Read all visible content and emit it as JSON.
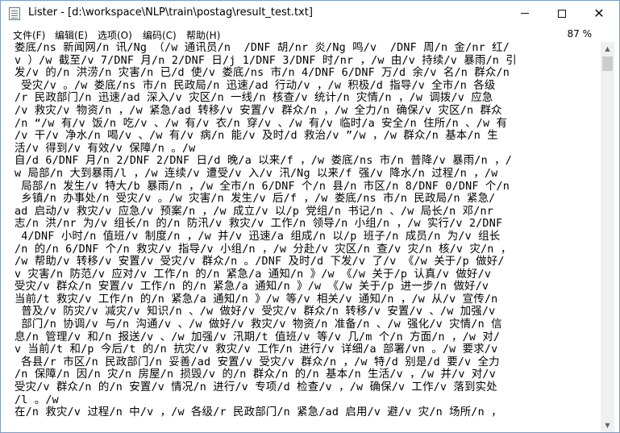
{
  "window": {
    "title": "Lister - [d:\\workspace\\NLP\\train\\postag\\result_test.txt]",
    "icon": "text-file-icon",
    "controls": {
      "minimize": "minimize-icon",
      "maximize": "maximize-icon",
      "close": "✕"
    }
  },
  "menubar": {
    "items": [
      {
        "label": "文件(F)"
      },
      {
        "label": "编辑(E)"
      },
      {
        "label": "选项(O)"
      },
      {
        "label": "编码(C)"
      },
      {
        "label": "帮助(H)"
      }
    ],
    "zoom": "87 %"
  },
  "content": {
    "lines": [
      "娄底/ns 新闻网/n 讯/Ng （/w 通讯员/n  /DNF 胡/nr 炎/Ng 鸣/v  /DNF 周/n 金/nr 红/",
      "v ）/w 截至/v 7/DNF 月/n 2/DNF 日/j 1/DNF 3/DNF 时/nr ，/w 由/v 持续/v 暴雨/n 引",
      "发/v 的/n 洪涝/n 灾害/n 已/d 使/v 娄底/ns 市/n 4/DNF 6/DNF 万/d 余/v 名/n 群众/n",
      " 受灾/v 。/w 娄底/ns 市/n 民政局/n 迅速/ad 行动/v ，/w 积极/d 指导/v 全市/n 各级",
      "/r 民政部门/n 迅速/ad 深入/v 灾区/n 一线/n 核查/v 统计/n 灾情/n ，/w 调拨/v 应急",
      "/v 救灾/v 物资/n ，/w 紧急/ad 转移/v 安置/v 群众/n ，/w 全力/n 确保/v 灾区/n 群众",
      "/n “/w 有/v 饭/n 吃/v 、/w 有/v 衣/n 穿/v 、/w 有/v 临时/a 安全/n 住所/n 、/w 有",
      "/v 干/v 净水/n 喝/v 、/w 有/v 病/n 能/v 及时/d 救治/v ”/w ，/w 群众/n 基本/n 生",
      "活/v 得到/v 有效/v 保障/n 。/w",
      "自/d 6/DNF 月/n 2/DNF 2/DNF 日/d 晚/a 以来/f ，/w 娄底/ns 市/n 普降/v 暴雨/n ，/",
      "w 局部/n 大到暴雨/l ，/w 连续/v 遭受/v 入/v 汛/Ng 以来/f 强/v 降水/n 过程/n ，/w",
      " 局部/n 发生/v 特大/b 暴雨/n ，/w 全市/n 6/DNF 个/n 县/n 市区/n 8/DNF 0/DNF 个/n",
      " 乡镇/n 办事处/n 受灾/v 。/w 灾害/n 发生/v 后/f ，/w 娄底/ns 市/n 民政局/n 紧急/",
      "ad 启动/v 救灾/v 应急/v 预案/n ，/w 成立/v 以/p 党组/n 书记/n 、/w 局长/n 邓/nr",
      "志/n 洪/nr 为/v 组长/n 的/n 防汛/v 救灾/v 工作/n 领导/n 小组/n ，/w 实行/v 2/DNF",
      " 4/DNF 小时/n 值班/v 制度/n ，/w 并/v 迅速/a 组成/n 以/p 班子/n 成员/n 为/v 组长",
      "/n 的/n 6/DNF 个/n 救灾/v 指导/v 小组/n ，/w 分赴/v 灾区/n 查/v 灾/n 核/v 灾/n ，",
      "/w 帮助/v 转移/v 安置/v 受灾/v 群众/n 。/DNF 及时/d 下发/v 了/v 《/w 关于/p 做好/",
      "v 灾害/n 防范/v 应对/v 工作/n 的/n 紧急/a 通知/n 》/w 《/w 关于/p 认真/v 做好/v",
      "受灾/v 群众/n 安置/v 工作/n 的/n 紧急/a 通知/n 》/w 《/w 关于/p 进一步/n 做好/v",
      "当前/t 救灾/v 工作/n 的/n 紧急/a 通知/n 》/w 等/v 相关/v 通知/n ，/w 从/v 宣传/n",
      " 普及/v 防灾/v 减灾/v 知识/n 、/w 做好/v 受灾/v 群众/n 转移/v 安置/v 、/w 加强/v",
      " 部门/n 协调/v 与/n 沟通/v 、/w 做好/v 救灾/v 物资/n 准备/n 、/w 强化/v 灾情/n 信",
      "息/n 管理/v 和/n 报送/v 、/w 加强/v 汛期/t 值班/v 等/v 几/m 个/n 方面/n ，/w 对/",
      "v 当前/t 和/p 今后/t 的/n 抗灾/v 救灾/v 工作/n 进行/v 详细/a 部署/vn 。/w 要求/v",
      " 各县/r 市区/n 民政部门/n 妥善/ad 安置/v 受灾/v 群众/n ，/w 特/d 别是/d 要/v 全力",
      "/n 保障/n 因/n 灾/n 房屋/n 损毁/v 的/n 群众/n 的/n 基本/n 生活/v ，/w 并/v 对/v",
      "受灾/v 群众/n 的/n 安置/v 情况/n 进行/v 专项/d 检查/v ，/w 确保/v 工作/v 落到实处",
      "/l 。/w",
      "在/n 救灾/v 过程/n 中/v ，/w 各级/r 民政部门/n 紧急/ad 启用/v 避/v 灾/n 场所/n ，"
    ]
  },
  "scrollbar": {
    "up_icon": "scroll-up-arrow-icon",
    "down_icon": "scroll-down-arrow-icon",
    "position": 0.0
  }
}
